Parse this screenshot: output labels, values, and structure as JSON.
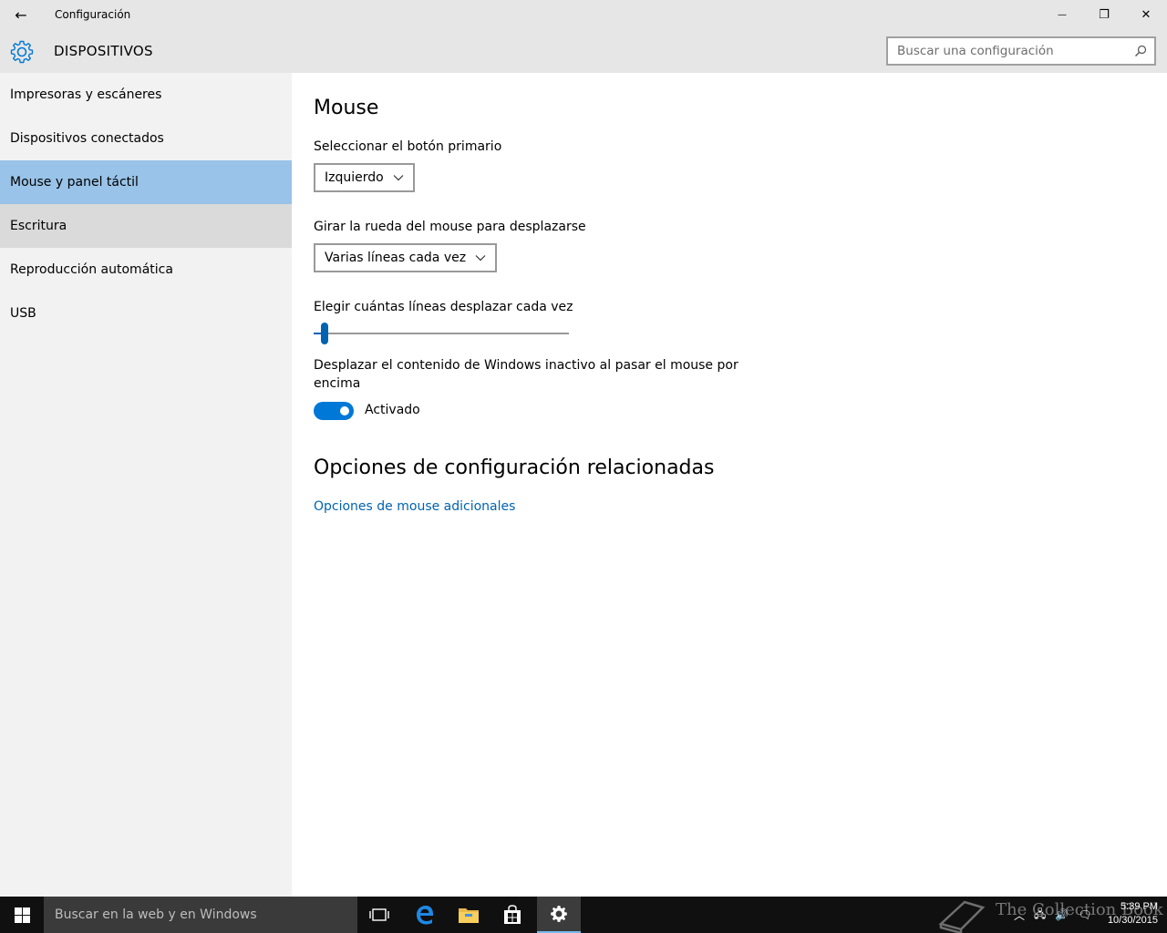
{
  "window": {
    "title": "Configuración",
    "back_icon": "←",
    "minimize_icon": "—",
    "maximize_icon": "❐",
    "close_icon": "✕"
  },
  "header": {
    "section_title": "DISPOSITIVOS",
    "search_placeholder": "Buscar una configuración"
  },
  "sidebar": {
    "items": [
      {
        "label": "Impresoras y escáneres"
      },
      {
        "label": "Dispositivos conectados"
      },
      {
        "label": "Mouse y panel táctil"
      },
      {
        "label": "Escritura"
      },
      {
        "label": "Reproducción automática"
      },
      {
        "label": "USB"
      }
    ]
  },
  "main": {
    "title": "Mouse",
    "primary_button": {
      "label": "Seleccionar el botón primario",
      "value": "Izquierdo"
    },
    "scroll_wheel": {
      "label": "Girar la rueda del mouse para desplazarse",
      "value": "Varias líneas cada vez"
    },
    "lines_slider": {
      "label": "Elegir cuántas líneas desplazar cada vez",
      "value_fraction": 0.03
    },
    "inactive_scroll": {
      "label_line1": "Desplazar el contenido de Windows inactivo al pasar el mouse por",
      "label_line2": "encima",
      "state": "Activado"
    },
    "related": {
      "title": "Opciones de configuración relacionadas",
      "link": "Opciones de mouse adicionales"
    }
  },
  "taskbar": {
    "search_text": "Buscar en la web y en Windows",
    "watermark": "The Collection Book",
    "time": "5:39 PM",
    "date": "10/30/2015",
    "accent_color": "#76b9ed"
  },
  "colors": {
    "accent": "#0078d7",
    "selected_nav": "#99c3e8",
    "link": "#0063b1"
  }
}
